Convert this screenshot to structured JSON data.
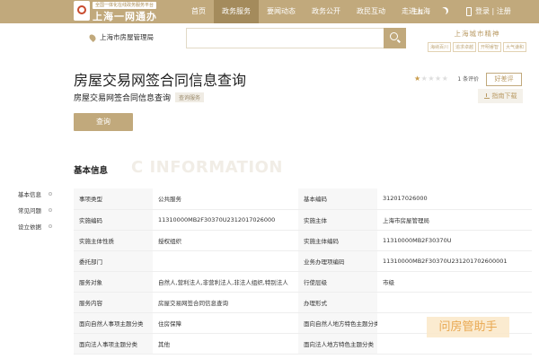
{
  "header": {
    "logo_tagline": "全国一体化在线政务服务平台",
    "logo_text": "上海一网通办",
    "nav": [
      "首页",
      "政务服务",
      "要闻动态",
      "政务公开",
      "政民互动",
      "走进上海"
    ],
    "nav_active_index": 1,
    "lang": "EN",
    "login": "登录 | 注册"
  },
  "search": {
    "location": "上海市房屋管理局",
    "placeholder": "",
    "brand_title": "上海城市精神",
    "brand_tags": [
      "海纳百川",
      "追求卓越",
      "开明睿智",
      "大气谦和"
    ]
  },
  "item": {
    "title": "房屋交易网签合同信息查询",
    "subtitle": "房屋交易网签合同信息查询",
    "tag": "查询服务",
    "rating_filled": 1,
    "rating_max": 5,
    "rating_count": "1 条评价",
    "review_label": "好差评",
    "guide_label": "指南下载",
    "query_label": "查询"
  },
  "section": {
    "title": "基本信息",
    "watermark": "C INFORMATION"
  },
  "side_nav": [
    "基本信息",
    "常见问题",
    "设立依据"
  ],
  "table": [
    [
      "事项类型",
      "公共服务",
      "基本编码",
      "312017026000"
    ],
    [
      "实施编码",
      "11310000MB2F30370U2312017026000",
      "实施主体",
      "上海市房屋管理局"
    ],
    [
      "实施主体性质",
      "授权组织",
      "实施主体编码",
      "11310000MB2F30370U"
    ],
    [
      "委托部门",
      "",
      "业务办理项编码",
      "11310000MB2F30370U231201702600001"
    ],
    [
      "服务对象",
      "自然人,营利法人,非营利法人,非法人组织,特别法人",
      "行使层级",
      "市级"
    ],
    [
      "服务内容",
      "房屋交易网签合同信息查询",
      "办理形式",
      ""
    ],
    [
      "面向自然人事项主题分类",
      "住房保障",
      "面向自然人地方特色主题分类",
      ""
    ],
    [
      "面向法人事项主题分类",
      "其他",
      "面向法人地方特色主题分类",
      ""
    ]
  ],
  "overlay_watermark": "问房管助手",
  "colors": {
    "brand": "#c1a97c",
    "brand_dark": "#a48b5c",
    "star": "#c89b4a"
  }
}
